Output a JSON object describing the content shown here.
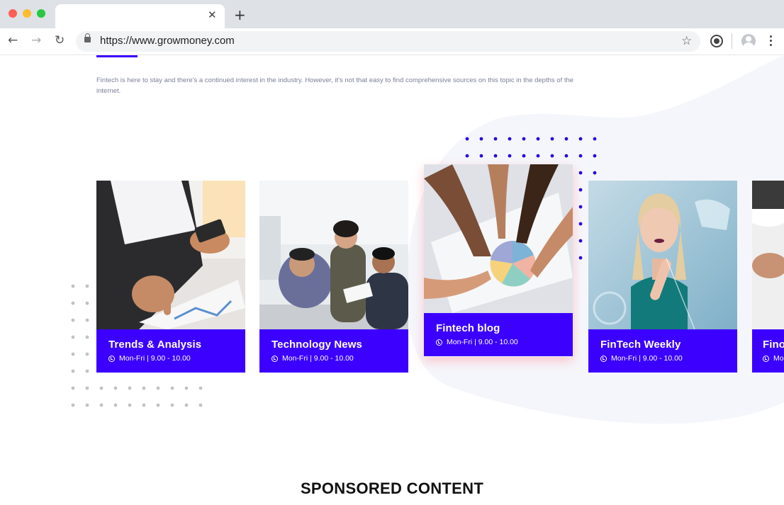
{
  "browser": {
    "url": "https://www.growmoney.com",
    "new_tab_glyph": "+",
    "close_glyph": "✕",
    "back_glyph": "←",
    "forward_glyph": "→",
    "reload_glyph": "↻",
    "star_glyph": "☆",
    "icons": [
      "back-icon",
      "forward-icon",
      "reload-icon",
      "lock-icon",
      "star-icon",
      "extension-icon",
      "profile-icon",
      "menu-icon"
    ]
  },
  "intro": {
    "text": "Fintech is here to stay and there's a continued interest in the industry. However, it's not that easy to find comprehensive sources on this topic in the depths of the internet."
  },
  "cards": [
    {
      "title": "Trends & Analysis",
      "schedule": "Mon-Fri | 9.00 - 10.00"
    },
    {
      "title": "Technology News",
      "schedule": "Mon-Fri | 9.00 - 10.00"
    },
    {
      "title": "Fintech blog",
      "schedule": "Mon-Fri | 9.00 - 10.00"
    },
    {
      "title": "FinTech Weekly",
      "schedule": "Mon-Fri | 9.00 - 10.00"
    },
    {
      "title": "Fino",
      "schedule": "Mo"
    }
  ],
  "section": {
    "sponsored_heading": "SPONSORED CONTENT"
  },
  "colors": {
    "accent": "#3b00ff",
    "blob": "#f5f6fb",
    "dots_blue": "#2a00e0",
    "dots_gray": "#c2c2c2"
  }
}
